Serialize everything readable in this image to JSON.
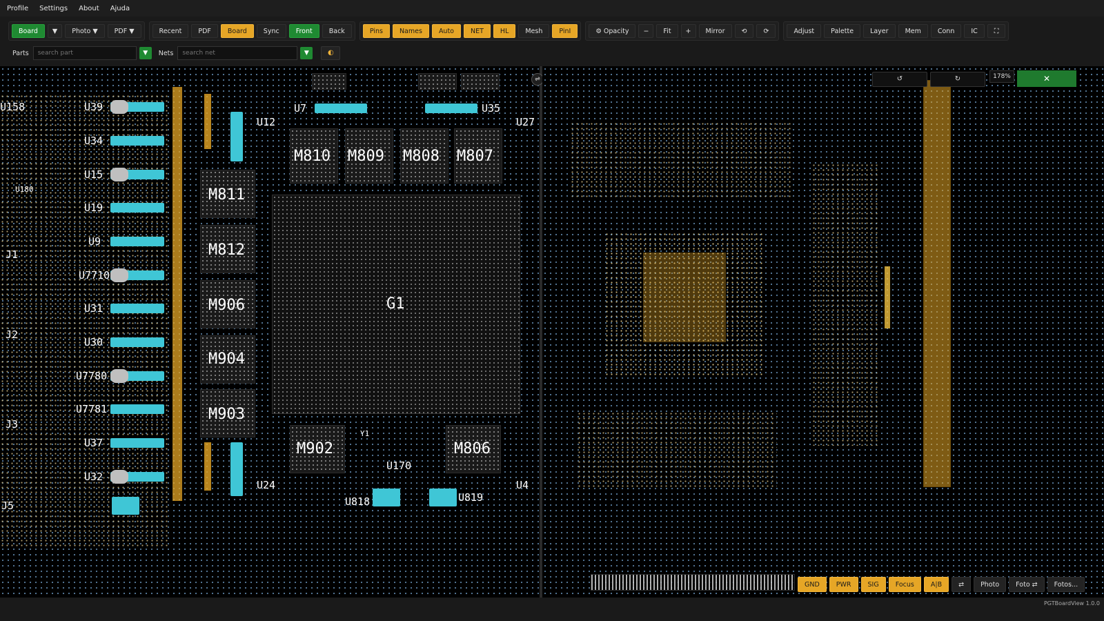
{
  "menu": [
    "Profile",
    "Settings",
    "About",
    "Ajuda"
  ],
  "toolbar": {
    "group1": [
      {
        "label": "Board",
        "style": "green"
      },
      {
        "label": "▼",
        "style": "dark"
      },
      {
        "label": "Photo ▼",
        "style": "dark"
      },
      {
        "label": "PDF ▼",
        "style": "dark"
      }
    ],
    "group2": [
      {
        "label": "Recent",
        "style": "dark"
      },
      {
        "label": "PDF",
        "style": "dark"
      },
      {
        "label": "Board",
        "style": "orange"
      },
      {
        "label": "Sync",
        "style": "dark"
      },
      {
        "label": "Front",
        "style": "green"
      },
      {
        "label": "Back",
        "style": "dark"
      }
    ],
    "group3": [
      {
        "label": "Pins",
        "style": "orange"
      },
      {
        "label": "Names",
        "style": "orange"
      },
      {
        "label": "Auto",
        "style": "orange"
      },
      {
        "label": "NET",
        "style": "orange"
      },
      {
        "label": "HL",
        "style": "orange"
      },
      {
        "label": "Mesh",
        "style": "dark"
      },
      {
        "label": "PinI",
        "style": "orange"
      }
    ],
    "group4": [
      {
        "label": "⚙ Opacity",
        "style": "dark"
      },
      {
        "label": "−",
        "style": "dark"
      },
      {
        "label": "Fit",
        "style": "dark"
      },
      {
        "label": "+",
        "style": "dark"
      },
      {
        "label": "Mirror",
        "style": "dark"
      },
      {
        "label": "⟲",
        "style": "dark"
      },
      {
        "label": "⟳",
        "style": "dark"
      }
    ],
    "group5": [
      {
        "label": "Adjust",
        "style": "dark"
      },
      {
        "label": "Palette",
        "style": "dark"
      },
      {
        "label": "Layer",
        "style": "dark"
      },
      {
        "label": "Mem",
        "style": "dark"
      },
      {
        "label": "Conn",
        "style": "dark"
      },
      {
        "label": "IC",
        "style": "dark"
      },
      {
        "label": "⛶",
        "style": "dark"
      }
    ]
  },
  "search": {
    "parts_label": "Parts",
    "parts_placeholder": "search part",
    "nets_label": "Nets",
    "nets_placeholder": "search net",
    "dropdown": "▼",
    "theme": "◐"
  },
  "board": {
    "gpu": "G1",
    "memory": [
      "M810",
      "M809",
      "M808",
      "M807",
      "M811",
      "M812",
      "M906",
      "M904",
      "M903",
      "M902",
      "M806"
    ],
    "left_refs": [
      "U158",
      "U39",
      "U34",
      "U15",
      "U180",
      "U19",
      "U9",
      "U7710",
      "U31",
      "U30",
      "U7780",
      "U7781",
      "U37",
      "U32"
    ],
    "connectors": [
      "J1",
      "J2",
      "J3",
      "J5"
    ],
    "misc_refs": [
      "U12",
      "U7",
      "U35",
      "U27",
      "U170",
      "U24",
      "U818",
      "U819",
      "U4",
      "Y1"
    ]
  },
  "right_view": {
    "rotate_left": "↺",
    "rotate_right": "↻",
    "zoom": "178%",
    "close": "✕"
  },
  "bottom": [
    {
      "label": "GND",
      "style": "orange"
    },
    {
      "label": "PWR",
      "style": "orange"
    },
    {
      "label": "SIG",
      "style": "orange"
    },
    {
      "label": "Focus",
      "style": "orange"
    },
    {
      "label": "A|B",
      "style": "orange"
    },
    {
      "label": "⇄",
      "style": "dark"
    },
    {
      "label": "Photo",
      "style": "dark"
    },
    {
      "label": "Foto ⇄",
      "style": "dark"
    },
    {
      "label": "Fotos...",
      "style": "dark"
    }
  ],
  "swap_icon": "⇌",
  "status": "PGTBoardView 1.0.0"
}
